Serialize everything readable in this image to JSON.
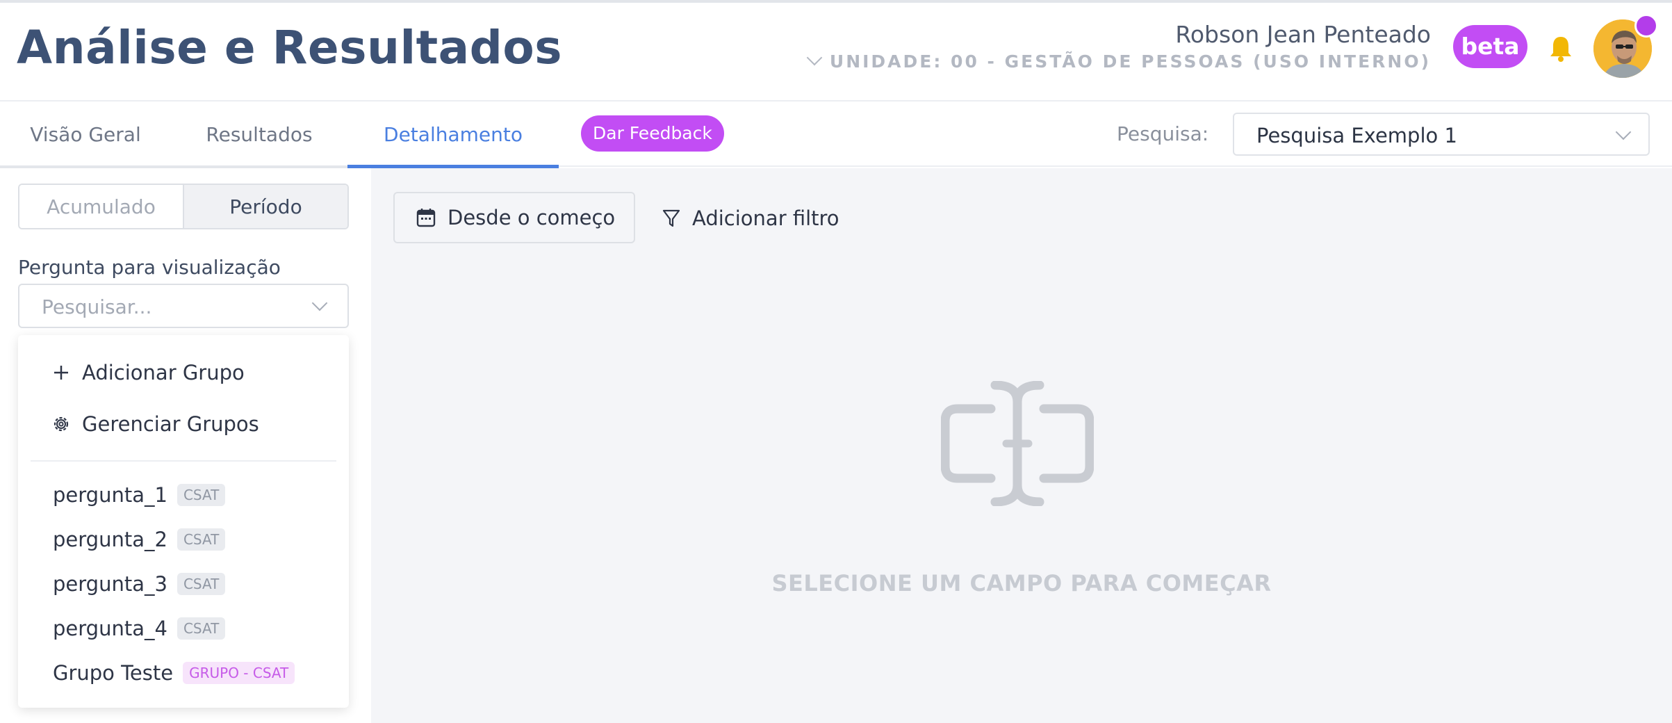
{
  "header": {
    "title": "Análise e Resultados",
    "user_name": "Robson Jean Penteado",
    "unit": "UNIDADE: 00 - GESTÃO DE PESSOAS (USO INTERNO)",
    "beta_label": "beta"
  },
  "tabs": [
    {
      "label": "Visão Geral"
    },
    {
      "label": "Resultados"
    },
    {
      "label": "Detalhamento",
      "active": true
    }
  ],
  "feedback_label": "Dar Feedback",
  "survey": {
    "label": "Pesquisa:",
    "selected": "Pesquisa Exemplo 1"
  },
  "sidebar": {
    "segments": [
      "Acumulado",
      "Período"
    ],
    "active_segment": "Período",
    "question_label": "Pergunta para visualização",
    "question_placeholder": "Pesquisar...",
    "dropdown": {
      "actions": [
        {
          "label": "Adicionar Grupo",
          "icon": "plus-icon"
        },
        {
          "label": "Gerenciar Grupos",
          "icon": "gear-icon"
        }
      ],
      "items": [
        {
          "label": "pergunta_1",
          "badge": "CSAT"
        },
        {
          "label": "pergunta_2",
          "badge": "CSAT"
        },
        {
          "label": "pergunta_3",
          "badge": "CSAT"
        },
        {
          "label": "pergunta_4",
          "badge": "CSAT"
        },
        {
          "label": "Grupo Teste",
          "badge": "GRUPO - CSAT"
        }
      ]
    }
  },
  "main": {
    "date_filter": "Desde o começo",
    "add_filter": "Adicionar filtro",
    "empty_message": "SELECIONE UM CAMPO PARA COMEÇAR"
  },
  "colors": {
    "accent": "#4a7fe0",
    "brand_purple": "#c24df4",
    "title": "#3d5275",
    "bell": "#f2b705"
  }
}
